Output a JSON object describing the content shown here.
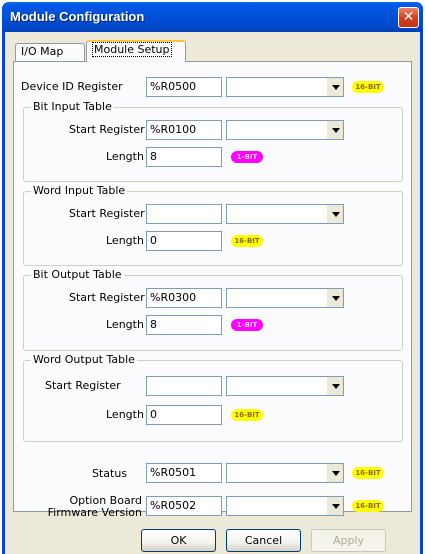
{
  "window": {
    "title": "Module Configuration",
    "close_glyph": "✕"
  },
  "tabs": [
    {
      "label": "I/O Map"
    },
    {
      "label": "Module Setup"
    }
  ],
  "device_id": {
    "label": "Device ID Register",
    "value": "%R0500",
    "badge": "16-BIT"
  },
  "bit_input": {
    "title": "Bit Input Table",
    "start_label": "Start Register",
    "start_value": "%R0100",
    "length_label": "Length",
    "length_value": "8",
    "badge": "1-BIT"
  },
  "word_input": {
    "title": "Word Input Table",
    "start_label": "Start Register",
    "start_value": "",
    "length_label": "Length",
    "length_value": "0",
    "badge": "16-BIT"
  },
  "bit_output": {
    "title": "Bit Output Table",
    "start_label": "Start Register",
    "start_value": "%R0300",
    "length_label": "Length",
    "length_value": "8",
    "badge": "1-BIT"
  },
  "word_output": {
    "title": "Word Output Table",
    "start_label": "Start Register",
    "start_value": "",
    "length_label": "Length",
    "length_value": "0",
    "badge": "16-BIT"
  },
  "status": {
    "label": "Status",
    "value": "%R0501",
    "badge": "16-BIT"
  },
  "firmware": {
    "label_line1": "Option Board",
    "label_line2": "Firmware Version",
    "value": "%R0502",
    "badge": "16-BIT"
  },
  "buttons": {
    "ok": "OK",
    "cancel": "Cancel",
    "apply": "Apply"
  }
}
